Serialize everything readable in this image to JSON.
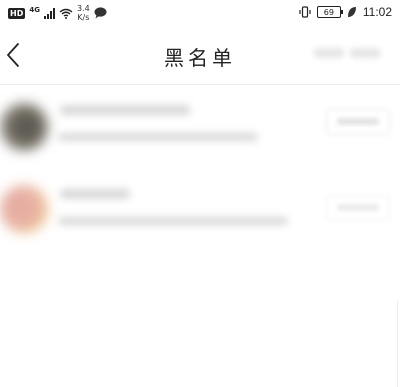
{
  "status_bar": {
    "hd_label": "HD",
    "network_label": "4G",
    "speed_value": "3.4",
    "speed_unit": "K/s",
    "battery_level": "69",
    "time": "11:02"
  },
  "navbar": {
    "title": "黑名单"
  },
  "blacklist": {
    "count_visible": 2
  }
}
